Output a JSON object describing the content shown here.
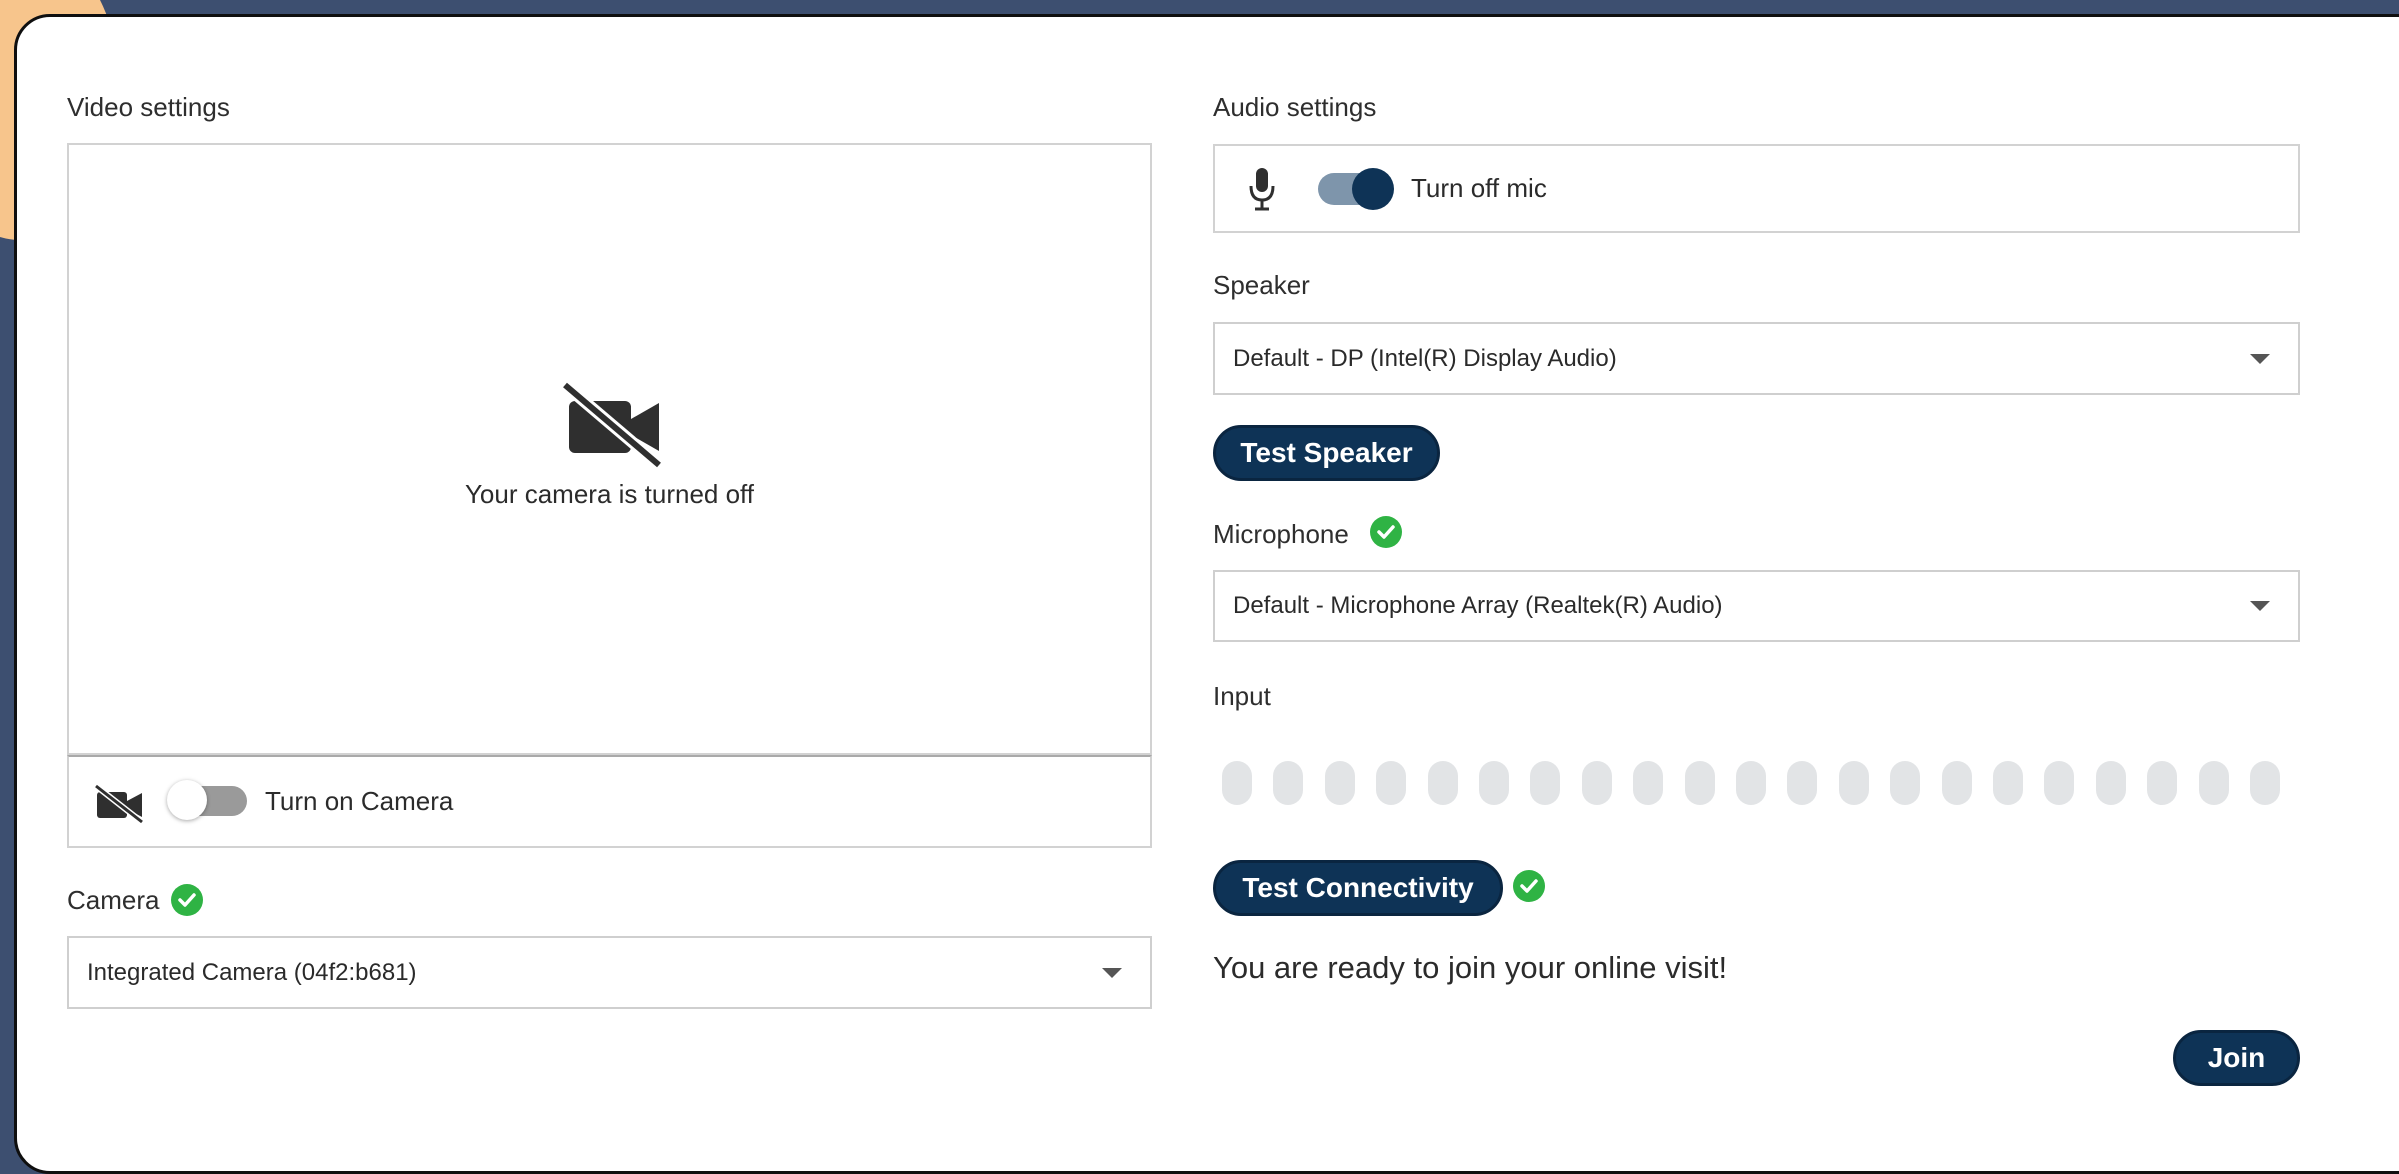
{
  "video": {
    "section_title": "Video settings",
    "camera_off_message": "Your camera is turned off",
    "camera_toggle_label": "Turn on Camera",
    "camera_toggle_on": false,
    "camera_label": "Camera",
    "camera_selected": "Integrated Camera (04f2:b681)"
  },
  "audio": {
    "section_title": "Audio settings",
    "mic_toggle_label": "Turn off mic",
    "mic_toggle_on": true,
    "speaker_label": "Speaker",
    "speaker_selected": "Default - DP (Intel(R) Display Audio)",
    "test_speaker_label": "Test Speaker",
    "microphone_label": "Microphone",
    "microphone_selected": "Default - Microphone Array (Realtek(R) Audio)",
    "input_label": "Input",
    "input_level": 0,
    "input_segments": 21
  },
  "connectivity": {
    "test_connectivity_label": "Test Connectivity",
    "ready_message": "You are ready to join your online visit!"
  },
  "join_label": "Join",
  "colors": {
    "primary": "#0e3356",
    "success": "#2fb344",
    "background": "#3d4f70"
  }
}
